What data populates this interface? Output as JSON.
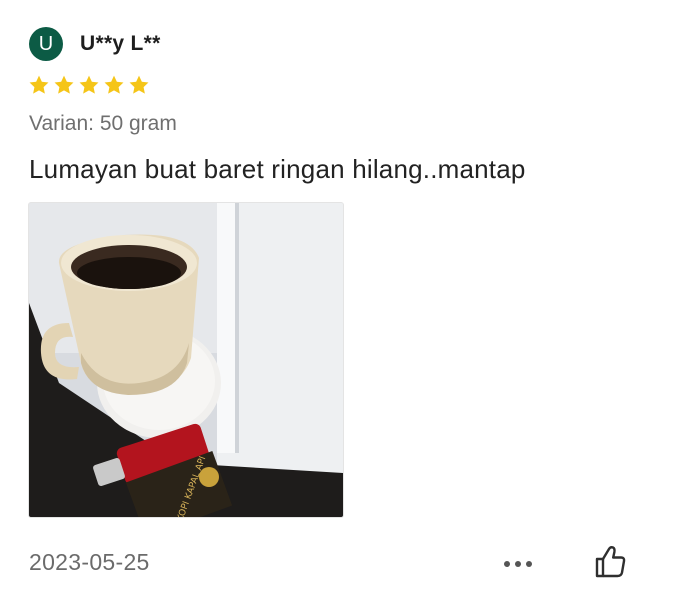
{
  "review": {
    "avatar_letter": "U",
    "username": "U**y L**",
    "rating": 5,
    "rating_max": 5,
    "variant": "Varian: 50 gram",
    "comment": "Lumayan buat baret ringan hilang..mantap",
    "date": "2023-05-25"
  },
  "photo": {
    "package_text": "KOPI KAPAL API"
  },
  "icons": {
    "star": "star-icon",
    "more": "more-options-icon",
    "like": "thumbs-up-icon"
  },
  "colors": {
    "avatar": "#0c5b45",
    "star": "#f5c518",
    "muted_text": "#6f6f6f",
    "main_text": "#222222"
  }
}
